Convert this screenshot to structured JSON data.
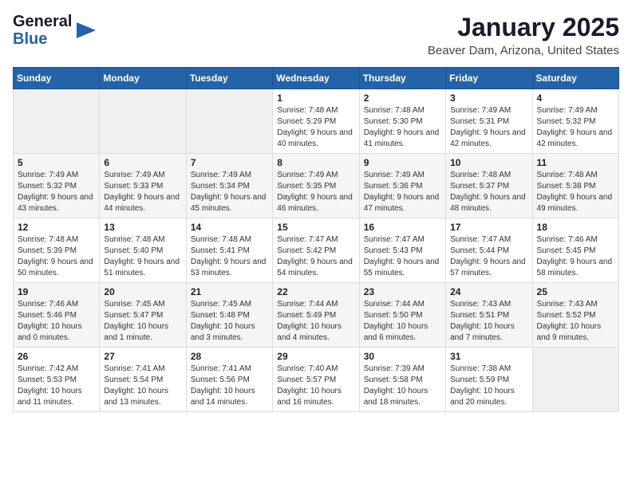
{
  "logo": {
    "line1": "General",
    "line2": "Blue"
  },
  "title": "January 2025",
  "location": "Beaver Dam, Arizona, United States",
  "weekdays": [
    "Sunday",
    "Monday",
    "Tuesday",
    "Wednesday",
    "Thursday",
    "Friday",
    "Saturday"
  ],
  "weeks": [
    [
      {
        "day": "",
        "sunrise": "",
        "sunset": "",
        "daylight": ""
      },
      {
        "day": "",
        "sunrise": "",
        "sunset": "",
        "daylight": ""
      },
      {
        "day": "",
        "sunrise": "",
        "sunset": "",
        "daylight": ""
      },
      {
        "day": "1",
        "sunrise": "Sunrise: 7:48 AM",
        "sunset": "Sunset: 5:29 PM",
        "daylight": "Daylight: 9 hours and 40 minutes."
      },
      {
        "day": "2",
        "sunrise": "Sunrise: 7:48 AM",
        "sunset": "Sunset: 5:30 PM",
        "daylight": "Daylight: 9 hours and 41 minutes."
      },
      {
        "day": "3",
        "sunrise": "Sunrise: 7:49 AM",
        "sunset": "Sunset: 5:31 PM",
        "daylight": "Daylight: 9 hours and 42 minutes."
      },
      {
        "day": "4",
        "sunrise": "Sunrise: 7:49 AM",
        "sunset": "Sunset: 5:32 PM",
        "daylight": "Daylight: 9 hours and 42 minutes."
      }
    ],
    [
      {
        "day": "5",
        "sunrise": "Sunrise: 7:49 AM",
        "sunset": "Sunset: 5:32 PM",
        "daylight": "Daylight: 9 hours and 43 minutes."
      },
      {
        "day": "6",
        "sunrise": "Sunrise: 7:49 AM",
        "sunset": "Sunset: 5:33 PM",
        "daylight": "Daylight: 9 hours and 44 minutes."
      },
      {
        "day": "7",
        "sunrise": "Sunrise: 7:49 AM",
        "sunset": "Sunset: 5:34 PM",
        "daylight": "Daylight: 9 hours and 45 minutes."
      },
      {
        "day": "8",
        "sunrise": "Sunrise: 7:49 AM",
        "sunset": "Sunset: 5:35 PM",
        "daylight": "Daylight: 9 hours and 46 minutes."
      },
      {
        "day": "9",
        "sunrise": "Sunrise: 7:49 AM",
        "sunset": "Sunset: 5:36 PM",
        "daylight": "Daylight: 9 hours and 47 minutes."
      },
      {
        "day": "10",
        "sunrise": "Sunrise: 7:48 AM",
        "sunset": "Sunset: 5:37 PM",
        "daylight": "Daylight: 9 hours and 48 minutes."
      },
      {
        "day": "11",
        "sunrise": "Sunrise: 7:48 AM",
        "sunset": "Sunset: 5:38 PM",
        "daylight": "Daylight: 9 hours and 49 minutes."
      }
    ],
    [
      {
        "day": "12",
        "sunrise": "Sunrise: 7:48 AM",
        "sunset": "Sunset: 5:39 PM",
        "daylight": "Daylight: 9 hours and 50 minutes."
      },
      {
        "day": "13",
        "sunrise": "Sunrise: 7:48 AM",
        "sunset": "Sunset: 5:40 PM",
        "daylight": "Daylight: 9 hours and 51 minutes."
      },
      {
        "day": "14",
        "sunrise": "Sunrise: 7:48 AM",
        "sunset": "Sunset: 5:41 PM",
        "daylight": "Daylight: 9 hours and 53 minutes."
      },
      {
        "day": "15",
        "sunrise": "Sunrise: 7:47 AM",
        "sunset": "Sunset: 5:42 PM",
        "daylight": "Daylight: 9 hours and 54 minutes."
      },
      {
        "day": "16",
        "sunrise": "Sunrise: 7:47 AM",
        "sunset": "Sunset: 5:43 PM",
        "daylight": "Daylight: 9 hours and 55 minutes."
      },
      {
        "day": "17",
        "sunrise": "Sunrise: 7:47 AM",
        "sunset": "Sunset: 5:44 PM",
        "daylight": "Daylight: 9 hours and 57 minutes."
      },
      {
        "day": "18",
        "sunrise": "Sunrise: 7:46 AM",
        "sunset": "Sunset: 5:45 PM",
        "daylight": "Daylight: 9 hours and 58 minutes."
      }
    ],
    [
      {
        "day": "19",
        "sunrise": "Sunrise: 7:46 AM",
        "sunset": "Sunset: 5:46 PM",
        "daylight": "Daylight: 10 hours and 0 minutes."
      },
      {
        "day": "20",
        "sunrise": "Sunrise: 7:45 AM",
        "sunset": "Sunset: 5:47 PM",
        "daylight": "Daylight: 10 hours and 1 minute."
      },
      {
        "day": "21",
        "sunrise": "Sunrise: 7:45 AM",
        "sunset": "Sunset: 5:48 PM",
        "daylight": "Daylight: 10 hours and 3 minutes."
      },
      {
        "day": "22",
        "sunrise": "Sunrise: 7:44 AM",
        "sunset": "Sunset: 5:49 PM",
        "daylight": "Daylight: 10 hours and 4 minutes."
      },
      {
        "day": "23",
        "sunrise": "Sunrise: 7:44 AM",
        "sunset": "Sunset: 5:50 PM",
        "daylight": "Daylight: 10 hours and 6 minutes."
      },
      {
        "day": "24",
        "sunrise": "Sunrise: 7:43 AM",
        "sunset": "Sunset: 5:51 PM",
        "daylight": "Daylight: 10 hours and 7 minutes."
      },
      {
        "day": "25",
        "sunrise": "Sunrise: 7:43 AM",
        "sunset": "Sunset: 5:52 PM",
        "daylight": "Daylight: 10 hours and 9 minutes."
      }
    ],
    [
      {
        "day": "26",
        "sunrise": "Sunrise: 7:42 AM",
        "sunset": "Sunset: 5:53 PM",
        "daylight": "Daylight: 10 hours and 11 minutes."
      },
      {
        "day": "27",
        "sunrise": "Sunrise: 7:41 AM",
        "sunset": "Sunset: 5:54 PM",
        "daylight": "Daylight: 10 hours and 13 minutes."
      },
      {
        "day": "28",
        "sunrise": "Sunrise: 7:41 AM",
        "sunset": "Sunset: 5:56 PM",
        "daylight": "Daylight: 10 hours and 14 minutes."
      },
      {
        "day": "29",
        "sunrise": "Sunrise: 7:40 AM",
        "sunset": "Sunset: 5:57 PM",
        "daylight": "Daylight: 10 hours and 16 minutes."
      },
      {
        "day": "30",
        "sunrise": "Sunrise: 7:39 AM",
        "sunset": "Sunset: 5:58 PM",
        "daylight": "Daylight: 10 hours and 18 minutes."
      },
      {
        "day": "31",
        "sunrise": "Sunrise: 7:38 AM",
        "sunset": "Sunset: 5:59 PM",
        "daylight": "Daylight: 10 hours and 20 minutes."
      },
      {
        "day": "",
        "sunrise": "",
        "sunset": "",
        "daylight": ""
      }
    ]
  ]
}
